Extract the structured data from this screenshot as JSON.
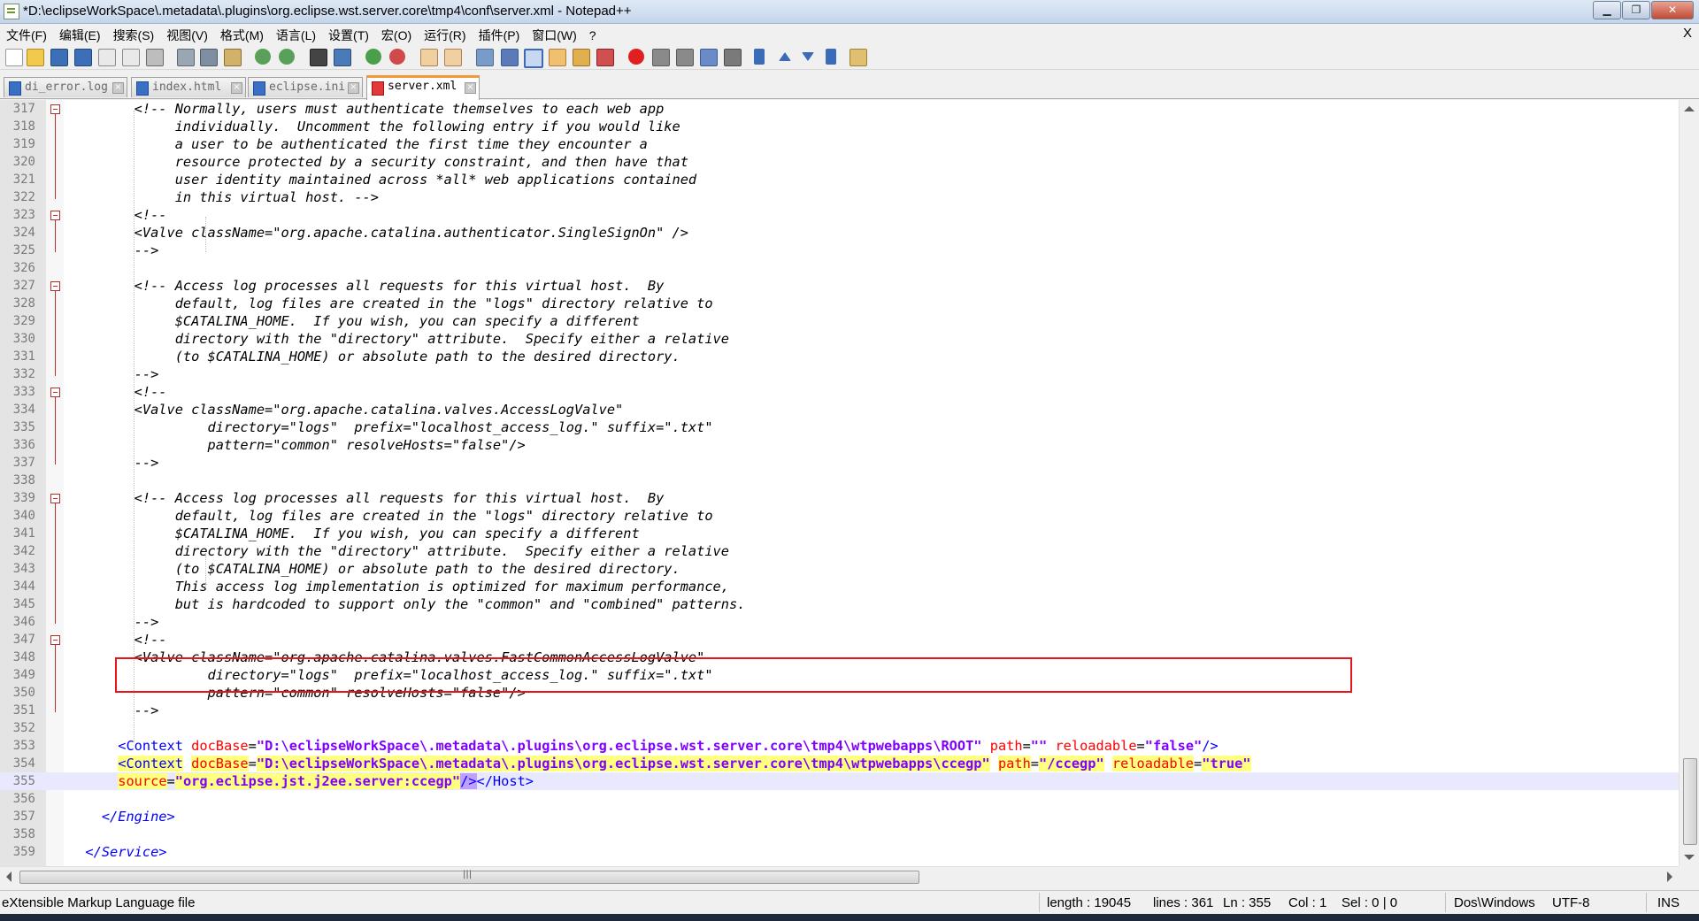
{
  "window": {
    "title": "*D:\\eclipseWorkSpace\\.metadata\\.plugins\\org.eclipse.wst.server.core\\tmp4\\conf\\server.xml - Notepad++",
    "minimize": "▁",
    "maximize": "❐",
    "close": "✕"
  },
  "menu": {
    "items": [
      "文件(F)",
      "编辑(E)",
      "搜索(S)",
      "视图(V)",
      "格式(M)",
      "语言(L)",
      "设置(T)",
      "宏(O)",
      "运行(R)",
      "插件(P)",
      "窗口(W)",
      "?"
    ],
    "close": "X"
  },
  "tabs": [
    {
      "label": "di_error.log",
      "active": false
    },
    {
      "label": "index.html",
      "active": false
    },
    {
      "label": "eclipse.ini",
      "active": false
    },
    {
      "label": "server.xml",
      "active": true
    }
  ],
  "editor": {
    "lines": [
      {
        "n": "317",
        "text": "        <!-- Normally, users must authenticate themselves to each web app"
      },
      {
        "n": "318",
        "text": "             individually.  Uncomment the following entry if you would like"
      },
      {
        "n": "319",
        "text": "             a user to be authenticated the first time they encounter a"
      },
      {
        "n": "320",
        "text": "             resource protected by a security constraint, and then have that"
      },
      {
        "n": "321",
        "text": "             user identity maintained across *all* web applications contained"
      },
      {
        "n": "322",
        "text": "             in this virtual host. -->"
      },
      {
        "n": "323",
        "text": "        <!--"
      },
      {
        "n": "324",
        "text": "        <Valve className=\"org.apache.catalina.authenticator.SingleSignOn\" />"
      },
      {
        "n": "325",
        "text": "        -->"
      },
      {
        "n": "326",
        "text": ""
      },
      {
        "n": "327",
        "text": "        <!-- Access log processes all requests for this virtual host.  By"
      },
      {
        "n": "328",
        "text": "             default, log files are created in the \"logs\" directory relative to"
      },
      {
        "n": "329",
        "text": "             $CATALINA_HOME.  If you wish, you can specify a different"
      },
      {
        "n": "330",
        "text": "             directory with the \"directory\" attribute.  Specify either a relative"
      },
      {
        "n": "331",
        "text": "             (to $CATALINA_HOME) or absolute path to the desired directory."
      },
      {
        "n": "332",
        "text": "        -->"
      },
      {
        "n": "333",
        "text": "        <!--"
      },
      {
        "n": "334",
        "text": "        <Valve className=\"org.apache.catalina.valves.AccessLogValve\""
      },
      {
        "n": "335",
        "text": "                 directory=\"logs\"  prefix=\"localhost_access_log.\" suffix=\".txt\""
      },
      {
        "n": "336",
        "text": "                 pattern=\"common\" resolveHosts=\"false\"/>"
      },
      {
        "n": "337",
        "text": "        -->"
      },
      {
        "n": "338",
        "text": ""
      },
      {
        "n": "339",
        "text": "        <!-- Access log processes all requests for this virtual host.  By"
      },
      {
        "n": "340",
        "text": "             default, log files are created in the \"logs\" directory relative to"
      },
      {
        "n": "341",
        "text": "             $CATALINA_HOME.  If you wish, you can specify a different"
      },
      {
        "n": "342",
        "text": "             directory with the \"directory\" attribute.  Specify either a relative"
      },
      {
        "n": "343",
        "text": "             (to $CATALINA_HOME) or absolute path to the desired directory."
      },
      {
        "n": "344",
        "text": "             This access log implementation is optimized for maximum performance,"
      },
      {
        "n": "345",
        "text": "             but is hardcoded to support only the \"common\" and \"combined\" patterns."
      },
      {
        "n": "346",
        "text": "        -->"
      },
      {
        "n": "347",
        "text": "        <!--"
      },
      {
        "n": "348",
        "text": "        <Valve className=\"org.apache.catalina.valves.FastCommonAccessLogValve\""
      },
      {
        "n": "349",
        "text": "                 directory=\"logs\"  prefix=\"localhost_access_log.\" suffix=\".txt\""
      },
      {
        "n": "350",
        "text": "                 pattern=\"common\" resolveHosts=\"false\"/>"
      },
      {
        "n": "351",
        "text": "        -->"
      },
      {
        "n": "352",
        "text": ""
      }
    ],
    "context_line_353": {
      "n": "353",
      "indent": "      ",
      "tag_open": "<Context",
      "attr1": "docBase",
      "val1": "\"D:\\eclipseWorkSpace\\.metadata\\.plugins\\org.eclipse.wst.server.core\\tmp4\\wtpwebapps\\ROOT\"",
      "attr2": "path",
      "val2": "\"\"",
      "attr3": "reloadable",
      "val3": "\"false\"",
      "tag_close": "/>"
    },
    "context_line_354": {
      "n": "354",
      "indent": "      ",
      "tag_open": "<Context",
      "attr1": "docBase",
      "val1": "\"D:\\eclipseWorkSpace\\.metadata\\.plugins\\org.eclipse.wst.server.core\\tmp4\\wtpwebapps\\ccegp\"",
      "attr2": "path",
      "val2": "\"/ccegp\"",
      "attr3": "reloadable",
      "val3": "\"true\""
    },
    "context_line_355": {
      "n": "355",
      "indent": "      ",
      "attr": "source",
      "val": "\"org.eclipse.jst.j2ee.server:ccegp\"",
      "tag_close": "/>",
      "host_close": "</Host>"
    },
    "tail_lines": [
      {
        "n": "356",
        "text": ""
      },
      {
        "n": "357",
        "text": "    </Engine>"
      },
      {
        "n": "358",
        "text": ""
      },
      {
        "n": "359",
        "text": "  </Service>"
      }
    ],
    "hscroll_grip": "|||"
  },
  "status": {
    "filetype": "eXtensible Markup Language file",
    "length": "length : 19045",
    "lines": "lines : 361",
    "ln": "Ln : 355",
    "col": "Col : 1",
    "sel": "Sel : 0 | 0",
    "eol": "Dos\\Windows",
    "encoding": "UTF-8",
    "mode": "INS"
  },
  "colors": {
    "tag": "#0000ff",
    "attribute": "#ff0000",
    "value": "#8000ff",
    "highlight_box": "#e8141c",
    "active_tab_accent": "#f09a3a"
  }
}
